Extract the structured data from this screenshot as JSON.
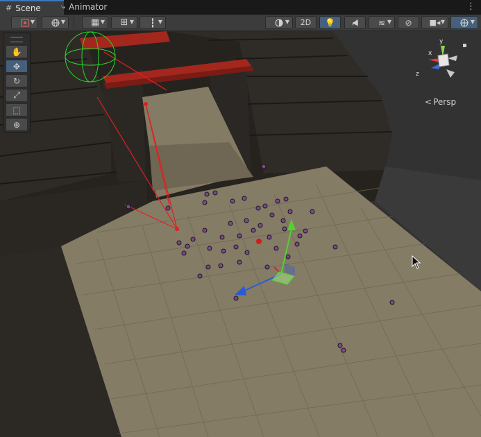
{
  "tabs": [
    {
      "label": "Scene",
      "icon": "grid-icon",
      "active": true
    },
    {
      "label": "Animator",
      "icon": "animator-icon",
      "active": false
    }
  ],
  "toolbar": {
    "mode_2d_label": "2D"
  },
  "gizmo": {
    "x_label": "x",
    "y_label": "y",
    "z_label": "z",
    "projection_label": "Persp"
  },
  "colors": {
    "accent": "#3a79bb",
    "active_button": "#46607c",
    "floor": "#857c66",
    "wall": "#2a2724",
    "beam": "#a4271d",
    "selection_line": "#e02020",
    "agent": "#7a4a8a"
  }
}
